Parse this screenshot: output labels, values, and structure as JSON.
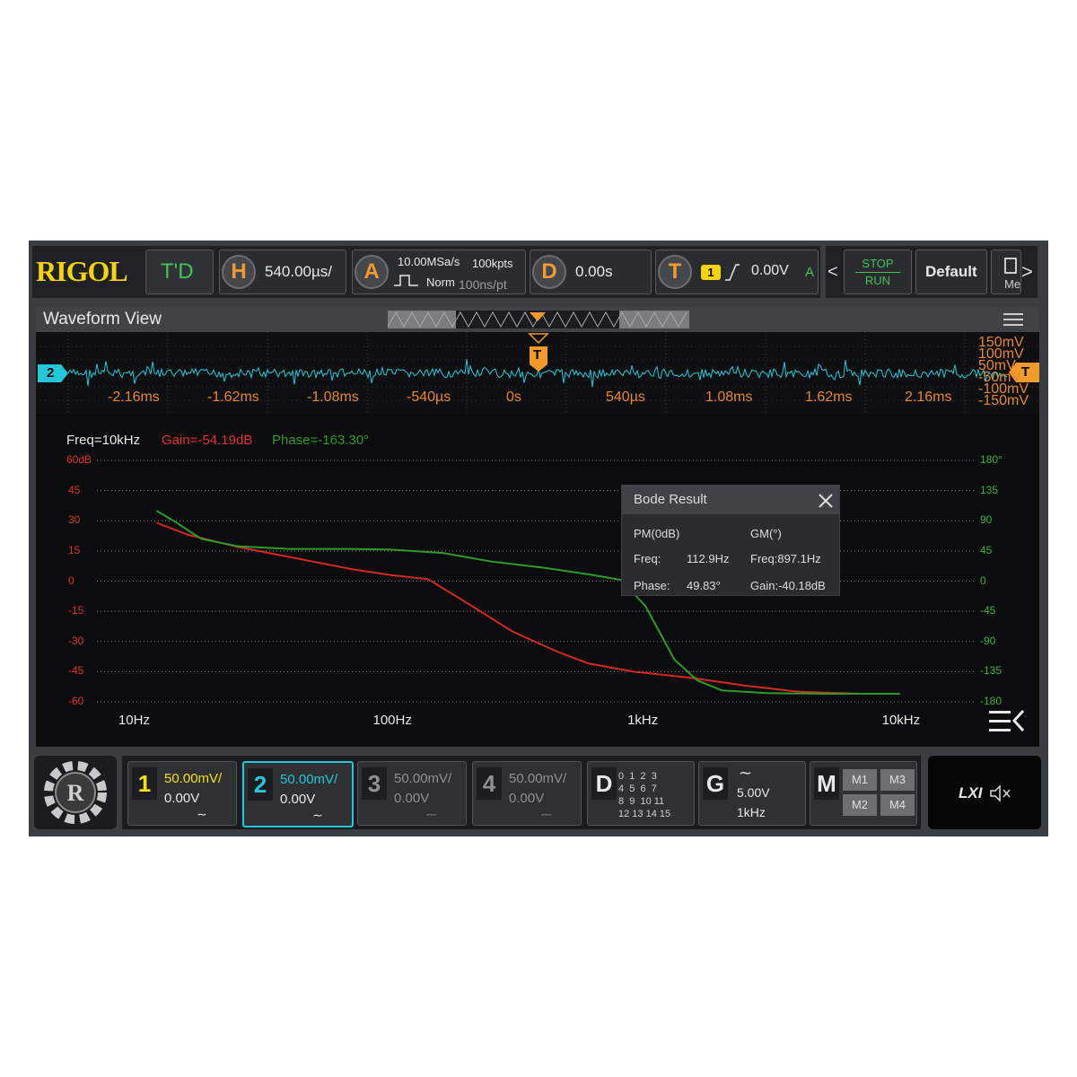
{
  "topbar": {
    "brand": "RIGOL",
    "mode": "T'D",
    "horizontal": {
      "label": "H",
      "scale": "540.00µs/"
    },
    "acquire": {
      "label": "A",
      "rate": "10.00MSa/s",
      "depth": "100kpts",
      "mode": "Norm",
      "resolution": "100ns/pt"
    },
    "delay": {
      "label": "D",
      "value": "0.00s"
    },
    "trigger": {
      "label": "T",
      "source": "1",
      "level": "0.00V",
      "status": "A"
    },
    "run_stop": {
      "stop": "STOP",
      "run": "RUN"
    },
    "default_label": "Default",
    "menu_label": "Me"
  },
  "waveform_view": {
    "title": "Waveform View",
    "channel_marker": "2",
    "trigger_marker": "T",
    "time_ticks": [
      "-2.16ms",
      "-1.62ms",
      "-1.08ms",
      "-540µs",
      "0s",
      "540µs",
      "1.08ms",
      "1.62ms",
      "2.16ms"
    ],
    "volt_ticks": [
      "150mV",
      "100mV",
      "50mV",
      "-50mV",
      "-100mV",
      "-150mV"
    ]
  },
  "bode": {
    "readout": {
      "freq": "Freq=10kHz",
      "gain": "Gain=-54.19dB",
      "phase": "Phase=-163.30°"
    },
    "result": {
      "title": "Bode Result",
      "pm_header": "PM(0dB)",
      "gm_header": "GM(°)",
      "freq_label": "Freq:",
      "pm_freq": "112.9Hz",
      "gm_freq": "Freq:897.1Hz",
      "phase_label": "Phase:",
      "pm_phase": "49.83°",
      "gm_gain": "Gain:-40.18dB"
    }
  },
  "chart_data": {
    "type": "line",
    "x_scale": "log",
    "xlim": [
      7,
      20000
    ],
    "x_ticks": [
      "10Hz",
      "100Hz",
      "1kHz",
      "10kHz"
    ],
    "y_left_ticks": [
      "60dB",
      "45",
      "30",
      "15",
      "0",
      "-15",
      "-30",
      "-45",
      "-60"
    ],
    "y_right_ticks": [
      "180°",
      "135",
      "90",
      "45",
      "0",
      "-45",
      "-90",
      "-135",
      "-180"
    ],
    "ylim_left": [
      -60,
      60
    ],
    "ylim_right": [
      -180,
      180
    ],
    "grid": true,
    "colors": {
      "gain": "#d12a22",
      "phase": "#2f9a2c"
    },
    "series": [
      {
        "axis": "left",
        "color": "#d12a22",
        "x": [
          12,
          16,
          25,
          40,
          70,
          100,
          140,
          200,
          300,
          450,
          600,
          900,
          1500,
          2500,
          4000,
          7000,
          10000
        ],
        "y": [
          29,
          23,
          17,
          12,
          6,
          3,
          1,
          -11,
          -25,
          -35,
          -41,
          -45,
          -48,
          -52,
          -55,
          -56,
          -56
        ]
      },
      {
        "axis": "right",
        "color": "#2f9a2c",
        "x": [
          12,
          14,
          18,
          25,
          40,
          70,
          100,
          160,
          250,
          400,
          600,
          800,
          1000,
          1300,
          1600,
          2000,
          3000,
          5000,
          10000
        ],
        "y": [
          105,
          90,
          63,
          52,
          48,
          48,
          47,
          42,
          29,
          20,
          10,
          2,
          -37,
          -117,
          -148,
          -163,
          -167,
          -168,
          -168
        ]
      }
    ]
  },
  "channels": [
    {
      "num": "1",
      "scale": "50.00mV/",
      "offset": "0.00V",
      "coupling": "∼"
    },
    {
      "num": "2",
      "scale": "50.00mV/",
      "offset": "0.00V",
      "coupling": "∼"
    },
    {
      "num": "3",
      "scale": "50.00mV/",
      "offset": "0.00V",
      "coupling": "⎓"
    },
    {
      "num": "4",
      "scale": "50.00mV/",
      "offset": "0.00V",
      "coupling": "⎓"
    }
  ],
  "digital": {
    "label": "D",
    "rows": [
      "0  1  2  3",
      "4  5  6  7",
      "8  9  10 11",
      "12 13 14 15"
    ]
  },
  "generator": {
    "label": "G",
    "amplitude": "5.00V",
    "frequency": "1kHz",
    "wave": "∼"
  },
  "math": {
    "label": "M",
    "items": [
      "M1",
      "M3",
      "M2",
      "M4"
    ]
  },
  "status": {
    "lxi": "LXI"
  }
}
